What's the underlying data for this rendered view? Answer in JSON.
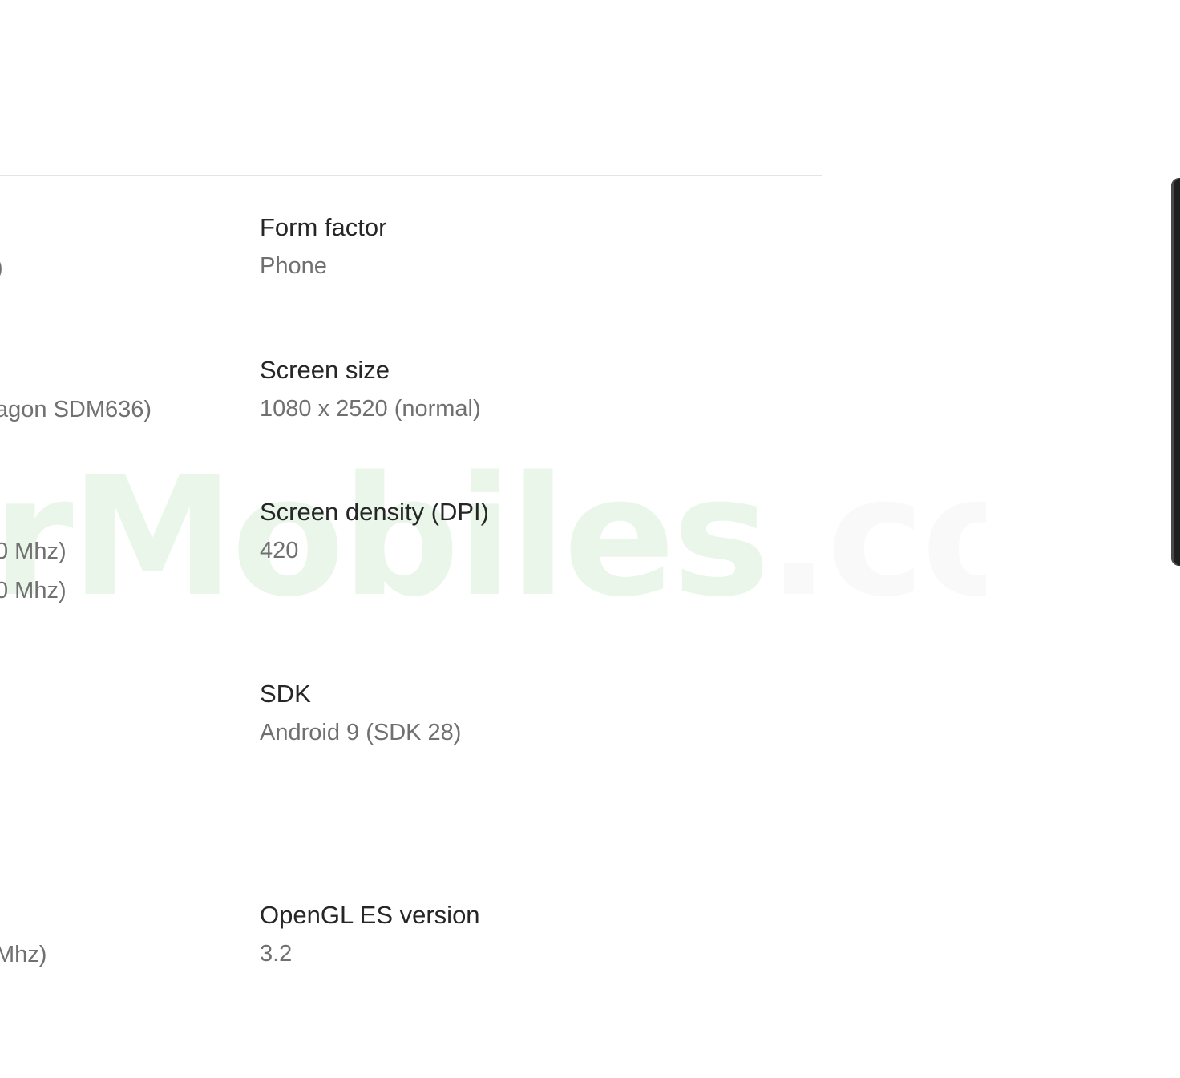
{
  "watermark": {
    "text_a": "rMobiles",
    "text_b": ".com"
  },
  "left_column": {
    "fragments": [
      ")",
      "agon SDM636)",
      "0 Mhz)",
      "0 Mhz)",
      "Mhz)"
    ]
  },
  "specs": [
    {
      "label": "Form factor",
      "value": "Phone"
    },
    {
      "label": "Screen size",
      "value": "1080 x 2520 (normal)"
    },
    {
      "label": "Screen density (DPI)",
      "value": "420"
    },
    {
      "label": "SDK",
      "value": "Android 9 (SDK 28)"
    },
    {
      "label": "OpenGL ES version",
      "value": "3.2"
    }
  ],
  "device_preview": {
    "color": "#1f1f1f"
  }
}
